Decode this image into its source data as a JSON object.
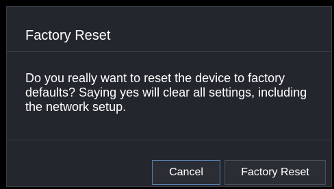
{
  "dialog": {
    "title": "Factory Reset",
    "message": "Do you really want to reset the device to factory defaults? Saying yes will clear all settings, including the network setup.",
    "cancel_label": "Cancel",
    "confirm_label": "Factory Reset"
  },
  "colors": {
    "background": "#23272d",
    "border": "#3a3f46",
    "text": "#ffffff",
    "focus_border": "#5a7fb0"
  }
}
